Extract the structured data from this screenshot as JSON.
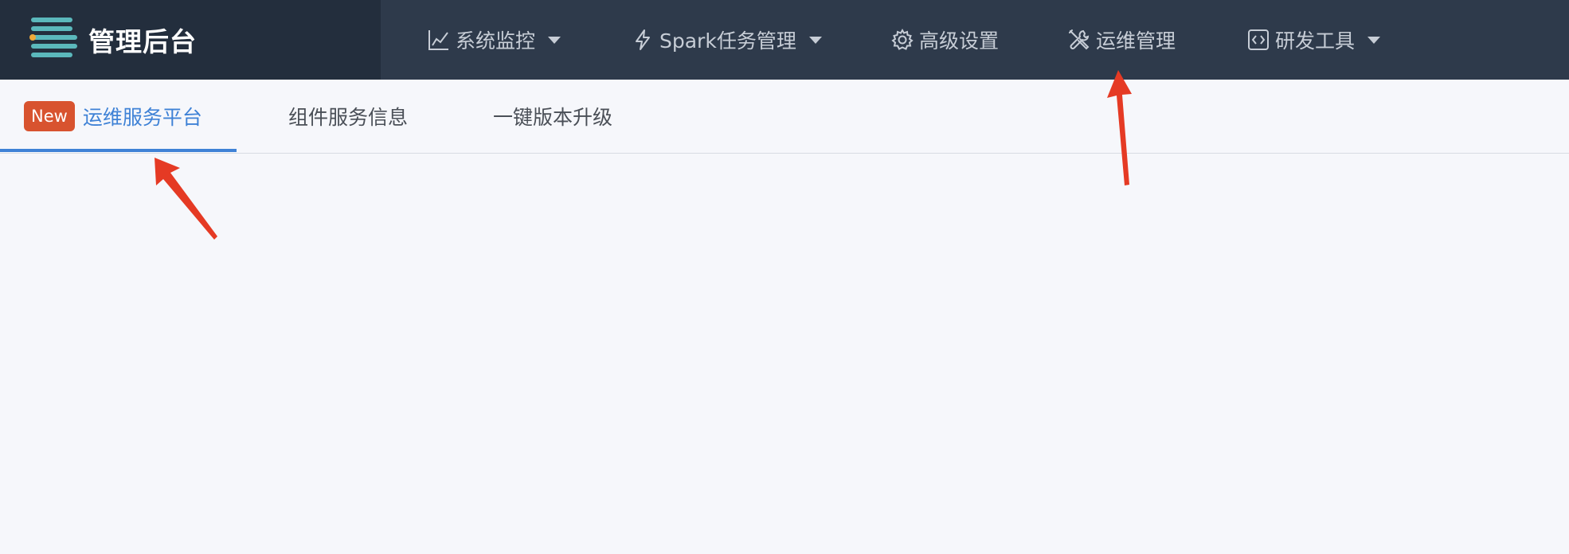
{
  "brand": {
    "title": "管理后台",
    "logo_icon": "stacked-bars-logo"
  },
  "topnav": {
    "items": [
      {
        "label": "系统监控",
        "icon": "line-chart-icon",
        "dropdown": true
      },
      {
        "label": "Spark任务管理",
        "icon": "lightning-icon",
        "dropdown": true
      },
      {
        "label": "高级设置",
        "icon": "gear-icon",
        "dropdown": false
      },
      {
        "label": "运维管理",
        "icon": "wrench-screwdriver-icon",
        "dropdown": false
      },
      {
        "label": "研发工具",
        "icon": "code-icon",
        "dropdown": true
      }
    ]
  },
  "tabs": {
    "badge": "New",
    "items": [
      {
        "label": "运维服务平台",
        "active": true
      },
      {
        "label": "组件服务信息",
        "active": false
      },
      {
        "label": "一键版本升级",
        "active": false
      }
    ]
  },
  "colors": {
    "header_bg": "#2e3a4b",
    "brand_bg": "#232e3d",
    "accent": "#3f82d6",
    "badge": "#d8532f",
    "annotation_arrow": "#e53a24",
    "page_bg": "#f6f7fb"
  }
}
